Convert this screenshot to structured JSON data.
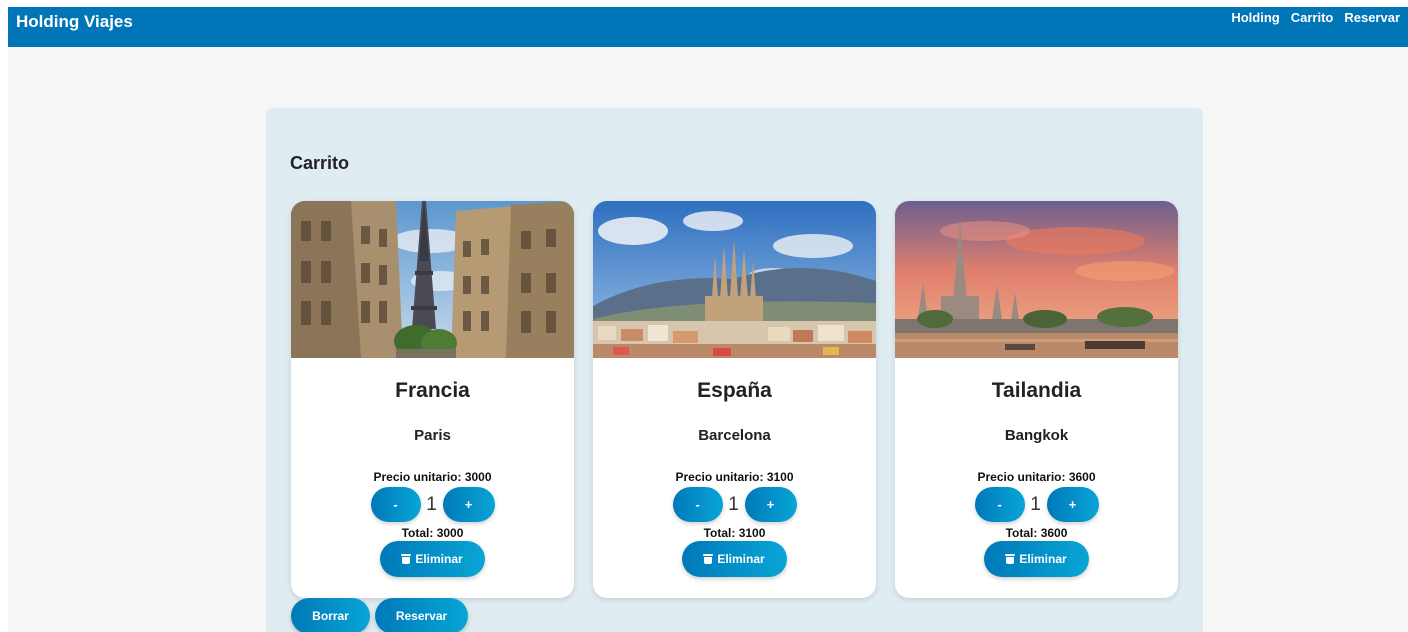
{
  "navbar": {
    "brand": "Holding Viajes",
    "links": [
      "Holding",
      "Carrito",
      "Reservar"
    ]
  },
  "cart": {
    "title": "Carrito",
    "items": [
      {
        "country": "Francia",
        "city": "Paris",
        "price_label": "Precio unitario: 3000",
        "quantity": "1",
        "total_label": "Total: 3000",
        "minus_label": "-",
        "plus_label": "+",
        "delete_label": "Eliminar",
        "image": "eiffel-tower-photo"
      },
      {
        "country": "España",
        "city": "Barcelona",
        "price_label": "Precio unitario: 3100",
        "quantity": "1",
        "total_label": "Total: 3100",
        "minus_label": "-",
        "plus_label": "+",
        "delete_label": "Eliminar",
        "image": "sagrada-familia-photo"
      },
      {
        "country": "Tailandia",
        "city": "Bangkok",
        "price_label": "Precio unitario: 3600",
        "quantity": "1",
        "total_label": "Total: 3600",
        "minus_label": "-",
        "plus_label": "+",
        "delete_label": "Eliminar",
        "image": "wat-arun-temple-photo"
      }
    ],
    "clear_label": "Borrar",
    "reserve_label": "Reservar"
  },
  "colors": {
    "navbar": "#0075b8",
    "panel": "#dfecf2",
    "button_start": "#0079b9",
    "button_end": "#08a5d6"
  }
}
